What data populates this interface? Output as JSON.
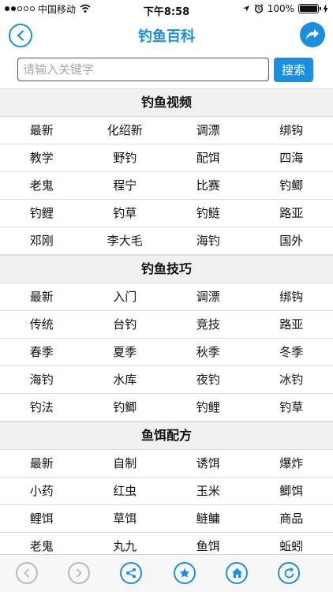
{
  "status_bar": {
    "carrier": "中国移动",
    "time": "下午8:58",
    "battery": "100%"
  },
  "nav": {
    "title": "钓鱼百科",
    "back_icon": "chevron-left-icon",
    "share_icon": "share-arrow-icon"
  },
  "search": {
    "placeholder": "请输入关键字",
    "value": "",
    "button_label": "搜索"
  },
  "sections": [
    {
      "title": "钓鱼视频",
      "rows": [
        [
          "最新",
          "化绍新",
          "调漂",
          "绑钩"
        ],
        [
          "教学",
          "野钓",
          "配饵",
          "四海"
        ],
        [
          "老鬼",
          "程宁",
          "比赛",
          "钓鲫"
        ],
        [
          "钓鲤",
          "钓草",
          "钓鲢",
          "路亚"
        ],
        [
          "邓刚",
          "李大毛",
          "海钓",
          "国外"
        ]
      ]
    },
    {
      "title": "钓鱼技巧",
      "rows": [
        [
          "最新",
          "入门",
          "调漂",
          "绑钩"
        ],
        [
          "传统",
          "台钓",
          "竞技",
          "路亚"
        ],
        [
          "春季",
          "夏季",
          "秋季",
          "冬季"
        ],
        [
          "海钓",
          "水库",
          "夜钓",
          "冰钓"
        ],
        [
          "钓法",
          "钓鲫",
          "钓鲤",
          "钓草"
        ]
      ]
    },
    {
      "title": "鱼饵配方",
      "rows": [
        [
          "最新",
          "自制",
          "诱饵",
          "爆炸"
        ],
        [
          "小药",
          "红虫",
          "玉米",
          "鲫饵"
        ],
        [
          "鲤饵",
          "草饵",
          "鲢鳙",
          "商品"
        ],
        [
          "老鬼",
          "丸九",
          "鱼饵",
          "蚯蚓"
        ]
      ]
    }
  ],
  "toolbar": {
    "icons": [
      "back-icon",
      "forward-icon",
      "share-icon",
      "favorite-star-icon",
      "home-icon",
      "refresh-icon"
    ],
    "accent": "#1a8fe0",
    "disabled": "#b9b9b9"
  }
}
